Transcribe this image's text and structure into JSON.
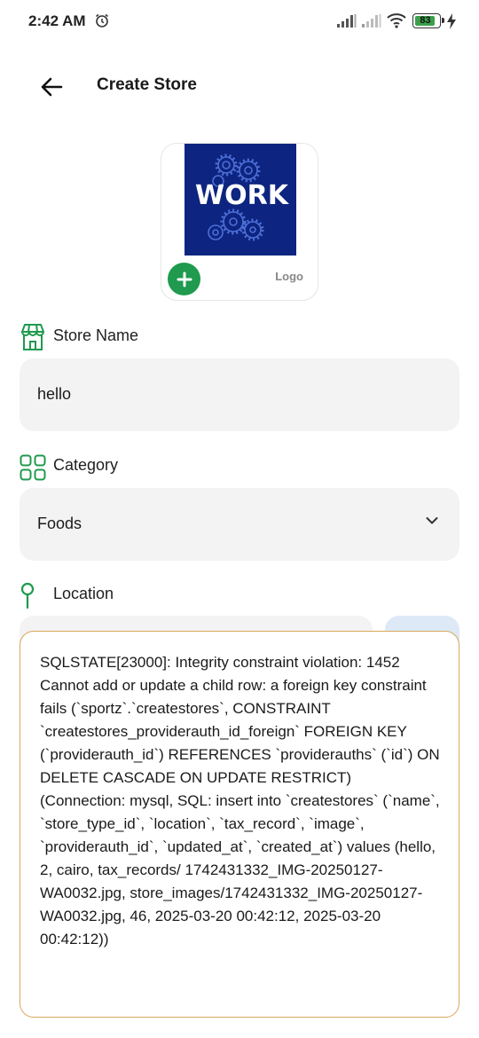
{
  "status_bar": {
    "time": "2:42 AM",
    "battery": "83",
    "icons": [
      "alarm-icon",
      "signal-icon",
      "signal-icon",
      "wifi-icon",
      "battery-icon",
      "charging-icon"
    ]
  },
  "app_bar": {
    "title": "Create Store",
    "back_icon": "arrow-left-icon"
  },
  "logo": {
    "label": "Logo",
    "image_text": "WORK",
    "add_icon": "plus-icon"
  },
  "fields": {
    "store_name": {
      "label": "Store Name",
      "icon": "store-icon",
      "value": "hello"
    },
    "category": {
      "label": "Category",
      "icon": "grid-icon",
      "value": "Foods"
    },
    "location": {
      "label": "Location",
      "icon": "location-pin-icon"
    }
  },
  "colors": {
    "accent": "#1f9a4e",
    "field_bg": "#f3f3f3",
    "toast_border": "#d9a85b",
    "logo_bg": "#0d2580"
  },
  "error_toast": {
    "message": "SQLSTATE[23000]: Integrity constraint violation: 1452 Cannot add or update a child row: a foreign key constraint fails (`sportz`.`createstores`, CONSTRAINT `createstores_providerauth_id_foreign` FOREIGN KEY (`providerauth_id`) REFERENCES `providerauths` (`id`) ON DELETE CASCADE ON UPDATE RESTRICT) (Connection: mysql, SQL: insert into `createstores` (`name`, `store_type_id`, `location`, `tax_record`, `image`, `providerauth_id`, `updated_at`, `created_at`) values (hello, 2, cairo, tax_records/ 1742431332_IMG-20250127-WA0032.jpg, store_images/1742431332_IMG-20250127-WA0032.jpg, 46, 2025-03-20 00:42:12, 2025-03-20 00:42:12))"
  }
}
